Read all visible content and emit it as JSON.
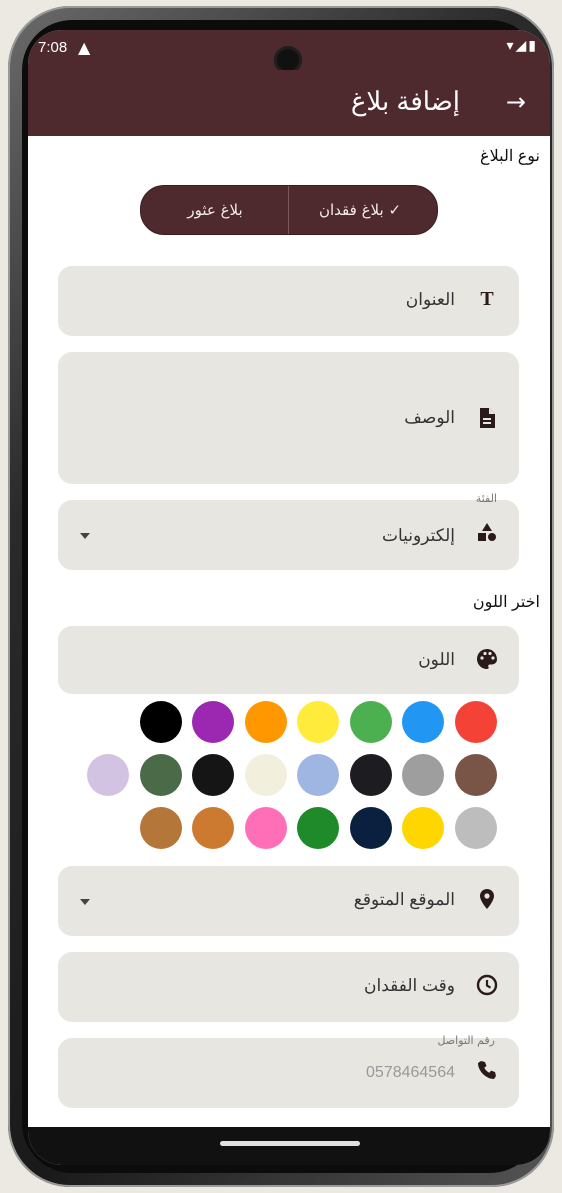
{
  "status_bar": {
    "time": "7:08",
    "warning_icon": "warning-icon",
    "right_icons": "▾◢▮"
  },
  "app_bar": {
    "title": "إضافة بلاغ",
    "back_icon": "arrow-right-icon"
  },
  "report_type": {
    "label": "نوع البلاغ",
    "options": [
      {
        "label": "بلاغ عثور",
        "selected": false
      },
      {
        "label": "بلاغ فقدان",
        "selected": true
      }
    ]
  },
  "fields": {
    "title": {
      "placeholder": "العنوان",
      "icon": "text-icon"
    },
    "description": {
      "placeholder": "الوصف",
      "icon": "document-icon"
    },
    "category": {
      "floating_label": "الفئة",
      "value": "إلكترونيات",
      "icon": "category-icon"
    },
    "color": {
      "placeholder": "اللون",
      "icon": "palette-icon"
    },
    "location": {
      "placeholder": "الموقع المتوقع",
      "icon": "location-pin-icon"
    },
    "lost_time": {
      "placeholder": "وقت الفقدان",
      "icon": "clock-icon"
    },
    "phone": {
      "floating_label": "رقم التواصل",
      "value": "0578464564",
      "icon": "phone-icon"
    }
  },
  "color_section": {
    "label": "اختر اللون"
  },
  "swatches": {
    "row1": [
      "#f44336",
      "#2196f3",
      "#4caf50",
      "#ffeb3b",
      "#ff9800",
      "#9c27b0",
      "#000000"
    ],
    "row2": [
      "#795548",
      "#9e9e9e",
      "#1c1c21",
      "#9fb6e2",
      "#f2f0dc",
      "#151515",
      "#4b6a48",
      "#d2c3e2"
    ],
    "row3": [
      "#bdbdbd",
      "#ffd600",
      "#0b1f3f",
      "#1f8a2a",
      "#ff6fb8",
      "#cc7a30",
      "#b5763a"
    ]
  }
}
